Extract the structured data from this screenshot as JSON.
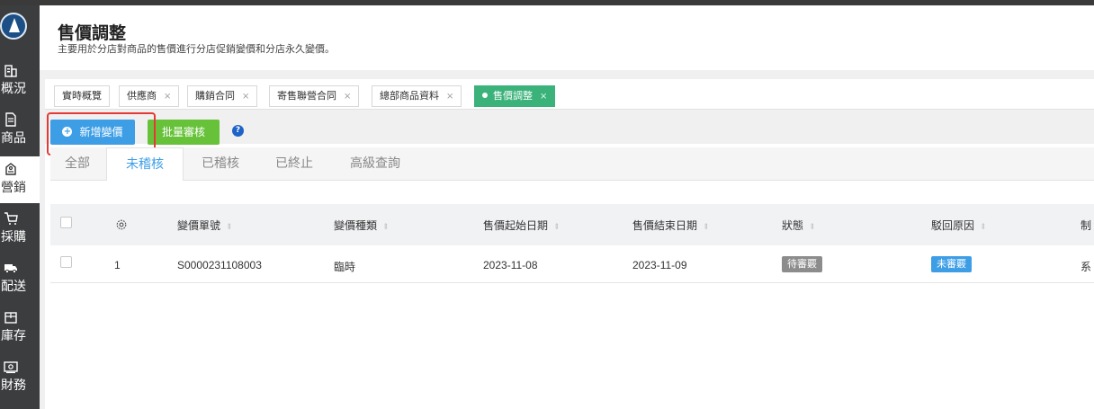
{
  "header": {
    "title": "售價調整",
    "subtitle": "主要用於分店對商品的售價進行分店促銷變價和分店永久變價。"
  },
  "sidebar": {
    "items": [
      {
        "label": "概況",
        "icon": "building-icon"
      },
      {
        "label": "商品",
        "icon": "document-icon"
      },
      {
        "label": "營銷",
        "icon": "tag-icon"
      },
      {
        "label": "採購",
        "icon": "cart-icon"
      },
      {
        "label": "配送",
        "icon": "truck-icon"
      },
      {
        "label": "庫存",
        "icon": "box-icon"
      },
      {
        "label": "財務",
        "icon": "money-icon"
      }
    ]
  },
  "tabs": [
    {
      "label": "實時概覽",
      "closable": false
    },
    {
      "label": "供應商",
      "closable": true
    },
    {
      "label": "購銷合同",
      "closable": true
    },
    {
      "label": "寄售聯營合同",
      "closable": true
    },
    {
      "label": "總部商品資料",
      "closable": true
    },
    {
      "label": "售價調整",
      "closable": true,
      "active": true
    }
  ],
  "tab_close": "×",
  "actions": {
    "add_label": "新增變價",
    "approve_label": "批量審核",
    "help": "?"
  },
  "status_tabs": [
    {
      "label": "全部"
    },
    {
      "label": "未稽核",
      "active": true
    },
    {
      "label": "已稽核"
    },
    {
      "label": "已終止"
    },
    {
      "label": "高級查詢"
    }
  ],
  "table": {
    "columns": [
      "變價單號",
      "變價種類",
      "售價起始日期",
      "售價結束日期",
      "狀態",
      "駁回原因",
      "制"
    ],
    "rows": [
      {
        "index": "1",
        "order_no": "S0000231108003",
        "type": "臨時",
        "start": "2023-11-08",
        "end": "2023-11-09",
        "status": "待審覈",
        "reason": "未審覈",
        "creator": "系"
      }
    ]
  },
  "colors": {
    "sidebar": "#3c3d3f",
    "primary": "#3d9ee6",
    "success": "#67c23a",
    "active_tab": "#3bb27a",
    "status_gray": "#8c8c8c",
    "highlight": "#e53935"
  }
}
